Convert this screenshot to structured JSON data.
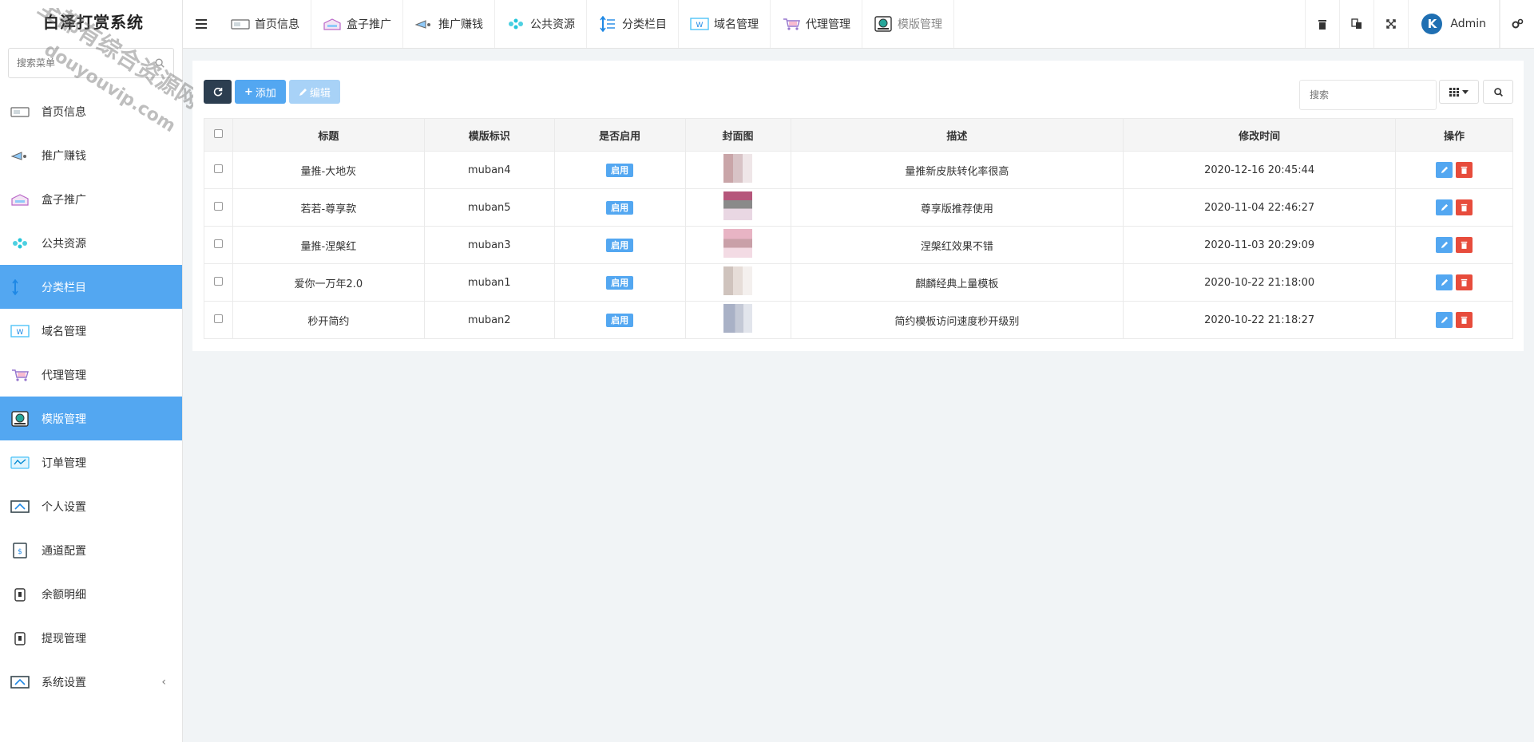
{
  "brand": {
    "title": "白泽打赏系统"
  },
  "sidebar": {
    "search_placeholder": "搜索菜单",
    "items": [
      {
        "label": "首页信息",
        "icon": "home-info-icon"
      },
      {
        "label": "推广赚钱",
        "icon": "promote-icon"
      },
      {
        "label": "盒子推广",
        "icon": "box-icon"
      },
      {
        "label": "公共资源",
        "icon": "resources-icon"
      },
      {
        "label": "分类栏目",
        "icon": "category-icon"
      },
      {
        "label": "域名管理",
        "icon": "domain-icon"
      },
      {
        "label": "代理管理",
        "icon": "agent-icon"
      },
      {
        "label": "模版管理",
        "icon": "template-icon"
      },
      {
        "label": "订单管理",
        "icon": "order-icon"
      },
      {
        "label": "个人设置",
        "icon": "profile-icon"
      },
      {
        "label": "通道配置",
        "icon": "channel-icon"
      },
      {
        "label": "余额明细",
        "icon": "balance-icon"
      },
      {
        "label": "提现管理",
        "icon": "withdraw-icon"
      },
      {
        "label": "系统设置",
        "icon": "settings-icon"
      }
    ],
    "settings_chevron": "‹"
  },
  "topbar": {
    "tabs": [
      {
        "label": "首页信息"
      },
      {
        "label": "盒子推广"
      },
      {
        "label": "推广赚钱"
      },
      {
        "label": "公共资源"
      },
      {
        "label": "分类栏目"
      },
      {
        "label": "域名管理"
      },
      {
        "label": "代理管理"
      },
      {
        "label": "模版管理"
      }
    ],
    "admin_label": "Admin",
    "avatar_letter": "K"
  },
  "toolbar": {
    "add_label": "添加",
    "edit_label": "编辑",
    "search_placeholder": "搜索"
  },
  "table": {
    "headers": [
      "标题",
      "模版标识",
      "是否启用",
      "封面图",
      "描述",
      "修改时间",
      "操作"
    ],
    "rows": [
      {
        "title": "量推-大地灰",
        "key": "muban4",
        "status": "启用",
        "desc": "量推新皮肤转化率很高",
        "time": "2020-12-16 20:45:44"
      },
      {
        "title": "若若-尊享款",
        "key": "muban5",
        "status": "启用",
        "desc": "尊享版推荐使用",
        "time": "2020-11-04 22:46:27"
      },
      {
        "title": "量推-涅槃红",
        "key": "muban3",
        "status": "启用",
        "desc": "涅槃红效果不错",
        "time": "2020-11-03 20:29:09"
      },
      {
        "title": "爱你一万年2.0",
        "key": "muban1",
        "status": "启用",
        "desc": "麒麟经典上量模板",
        "time": "2020-10-22 21:18:00"
      },
      {
        "title": "秒开简约",
        "key": "muban2",
        "status": "启用",
        "desc": "简约模板访问速度秒开级别",
        "time": "2020-10-22 21:18:27"
      }
    ]
  },
  "watermark": {
    "line1": "全都有综合资源网",
    "line2": "douyouvip.com"
  },
  "colors": {
    "accent": "#53a7f1",
    "dark_button": "#2c3e50",
    "danger": "#e74c3c"
  }
}
